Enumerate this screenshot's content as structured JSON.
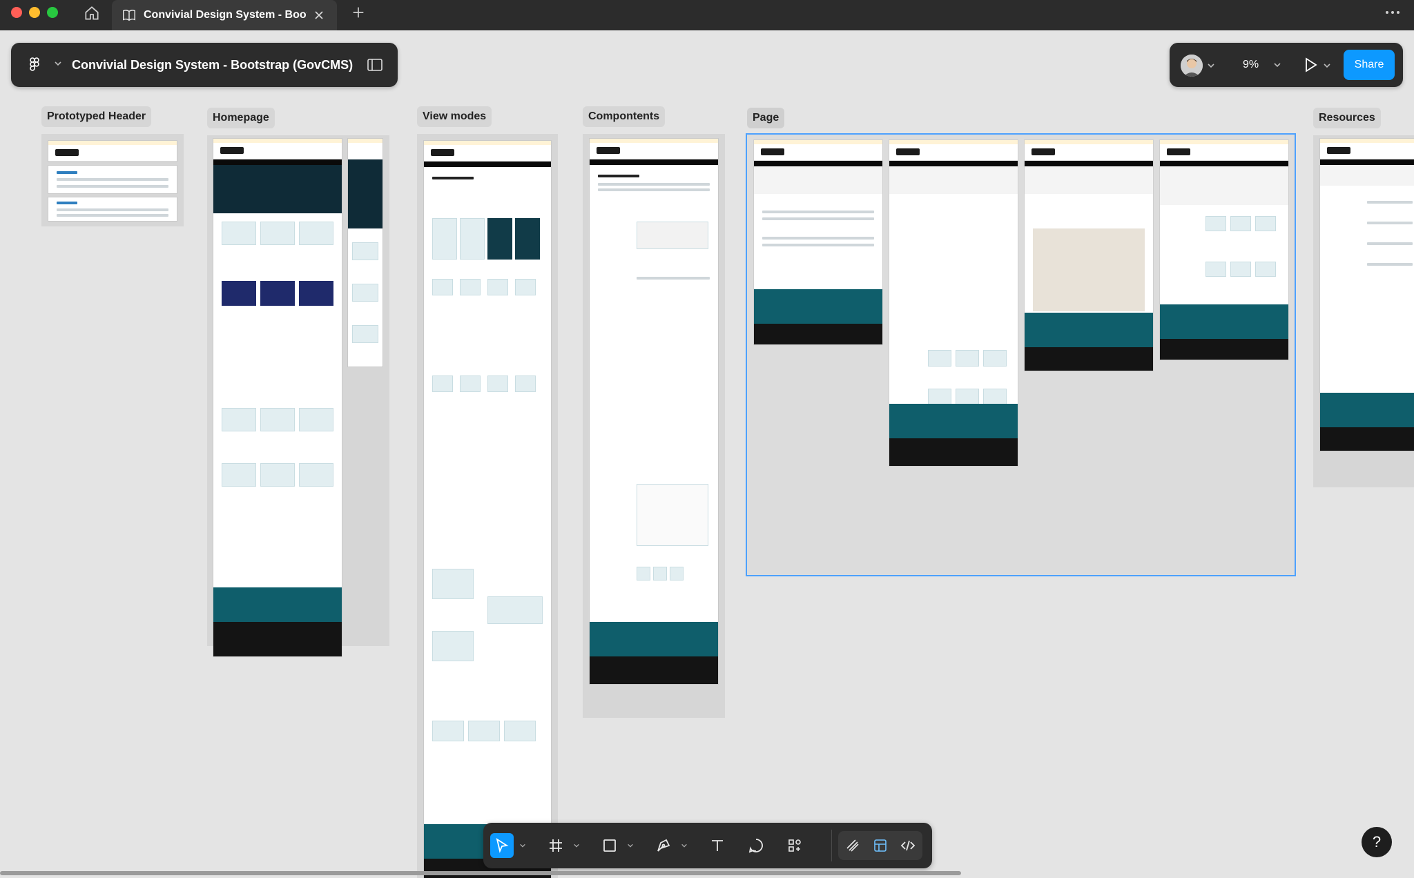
{
  "window": {
    "tab_title": "Convivial Design System - Bootstrap (GovCMS)"
  },
  "file": {
    "title": "Convivial Design System - Bootstrap (GovCMS)"
  },
  "toolbar": {
    "zoom": "9%",
    "share_label": "Share"
  },
  "sections": [
    {
      "label": "Prototyped Header"
    },
    {
      "label": "Homepage"
    },
    {
      "label": "View modes"
    },
    {
      "label": "Compontents"
    },
    {
      "label": "Page"
    },
    {
      "label": "Resources"
    }
  ],
  "tools": [
    {
      "name": "move-tool",
      "icon": "cursor-arrow-icon",
      "active": true
    },
    {
      "name": "frame-tool",
      "icon": "hash-frame-icon"
    },
    {
      "name": "shape-tool",
      "icon": "rectangle-icon"
    },
    {
      "name": "pen-tool",
      "icon": "pen-icon"
    },
    {
      "name": "text-tool",
      "icon": "text-T-icon"
    },
    {
      "name": "comment-tool",
      "icon": "speech-bubble-icon"
    },
    {
      "name": "actions-tool",
      "icon": "components-grid-icon"
    }
  ],
  "modes": [
    {
      "name": "draw-mode",
      "icon": "pencil-draw-icon"
    },
    {
      "name": "design-mode",
      "icon": "design-mode-icon"
    },
    {
      "name": "dev-mode",
      "icon": "code-brackets-icon"
    }
  ],
  "help": {
    "label": "?"
  },
  "colors": {
    "accent": "#0d99ff",
    "toolbar_bg": "#2c2c2c",
    "canvas_bg": "#e4e4e4",
    "selection": "#4da1ff",
    "footer_teal": "#0f5e6b"
  }
}
